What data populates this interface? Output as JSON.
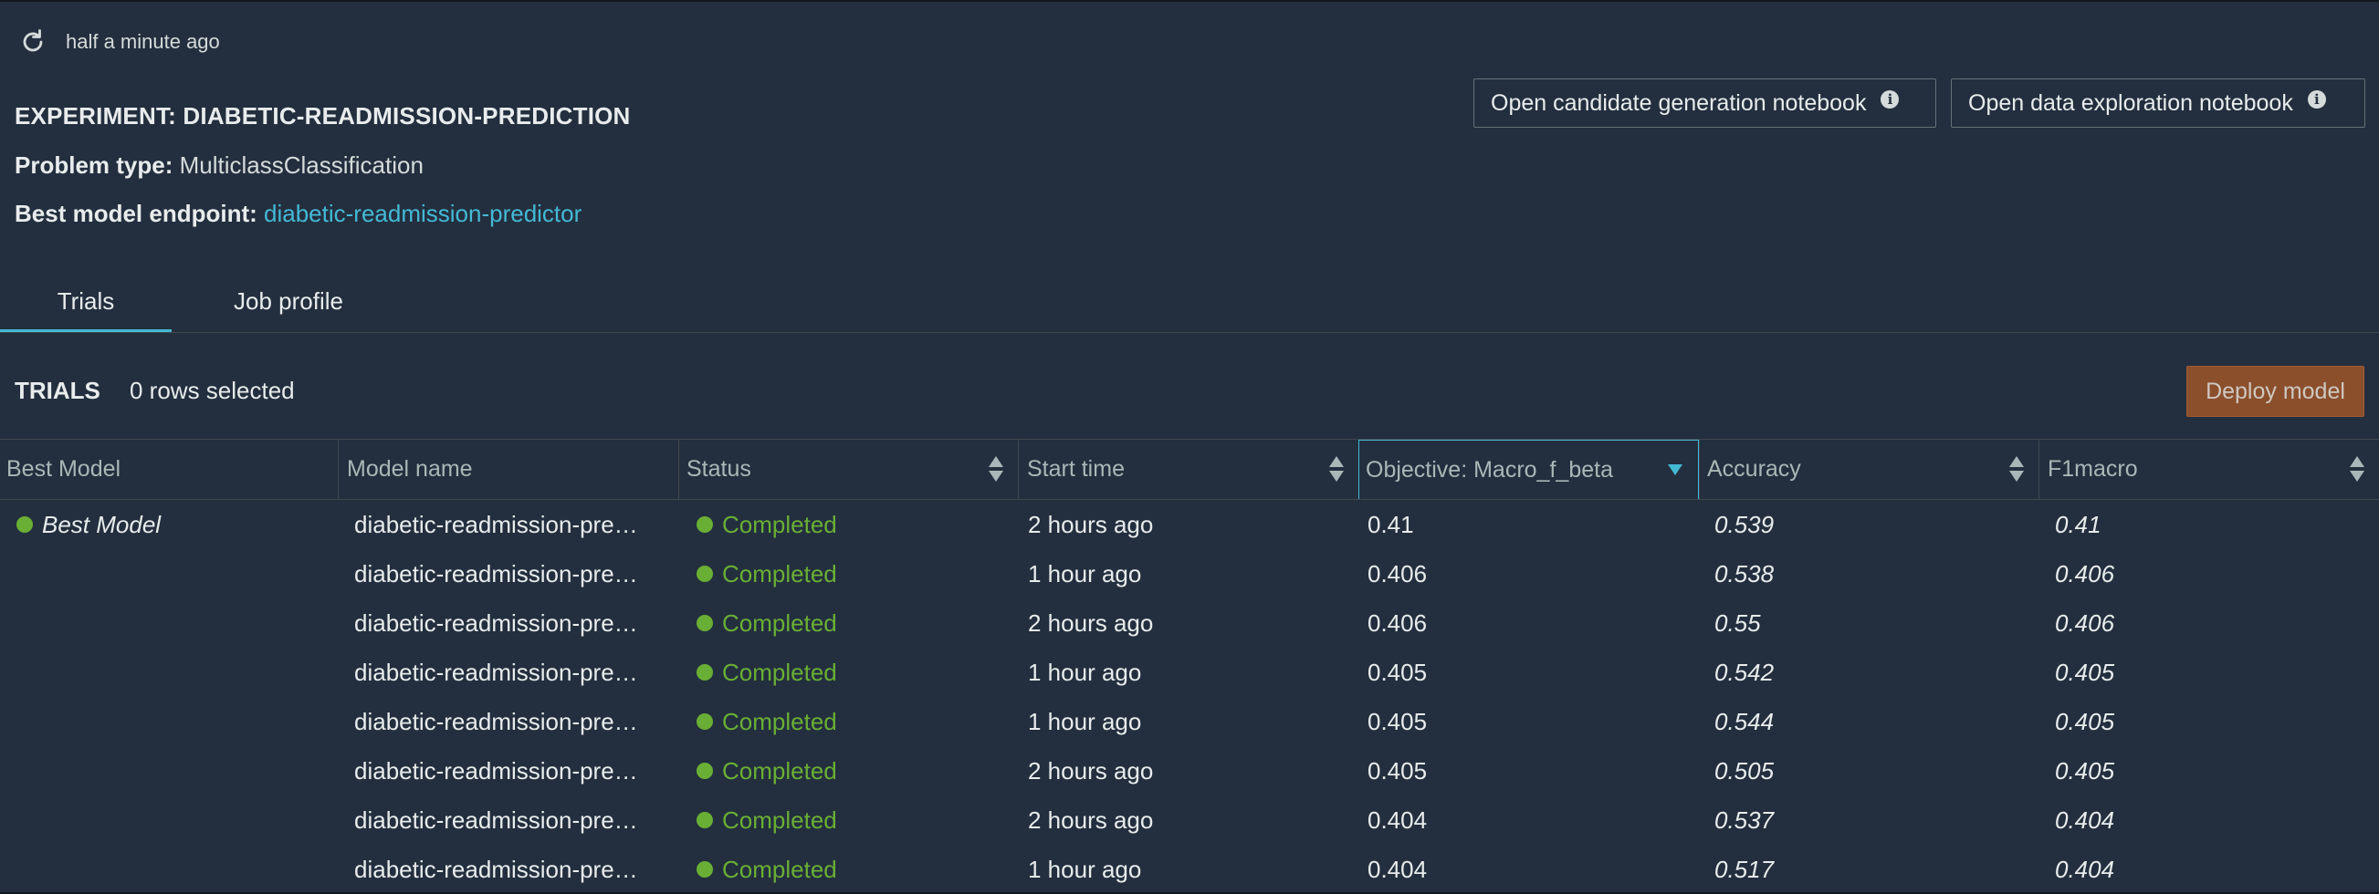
{
  "header": {
    "refresh_text": "half a minute ago",
    "experiment_title": "EXPERIMENT: DIABETIC-READMISSION-PREDICTION",
    "problem_type_label": "Problem type:",
    "problem_type_value": "MulticlassClassification",
    "endpoint_label": "Best model endpoint:",
    "endpoint_value": "diabetic-readmission-predictor"
  },
  "actions": {
    "candidate_notebook": "Open candidate generation notebook",
    "data_notebook": "Open data exploration notebook"
  },
  "tabs": [
    {
      "label": "Trials",
      "active": true
    },
    {
      "label": "Job profile",
      "active": false
    }
  ],
  "trials": {
    "title": "TRIALS",
    "rows_selected": "0 rows selected",
    "deploy_label": "Deploy model",
    "columns": [
      "Best Model",
      "Model name",
      "Status",
      "Start time",
      "Objective: Macro_f_beta",
      "Accuracy",
      "F1macro"
    ],
    "rows": [
      {
        "best": "Best Model",
        "name": "diabetic-readmission-pre…",
        "status": "Completed",
        "start": "2 hours ago",
        "objective": "0.41",
        "accuracy": "0.539",
        "f1": "0.41"
      },
      {
        "best": "",
        "name": "diabetic-readmission-pre…",
        "status": "Completed",
        "start": "1 hour ago",
        "objective": "0.406",
        "accuracy": "0.538",
        "f1": "0.406"
      },
      {
        "best": "",
        "name": "diabetic-readmission-pre…",
        "status": "Completed",
        "start": "2 hours ago",
        "objective": "0.406",
        "accuracy": "0.55",
        "f1": "0.406"
      },
      {
        "best": "",
        "name": "diabetic-readmission-pre…",
        "status": "Completed",
        "start": "1 hour ago",
        "objective": "0.405",
        "accuracy": "0.542",
        "f1": "0.405"
      },
      {
        "best": "",
        "name": "diabetic-readmission-pre…",
        "status": "Completed",
        "start": "1 hour ago",
        "objective": "0.405",
        "accuracy": "0.544",
        "f1": "0.405"
      },
      {
        "best": "",
        "name": "diabetic-readmission-pre…",
        "status": "Completed",
        "start": "2 hours ago",
        "objective": "0.405",
        "accuracy": "0.505",
        "f1": "0.405"
      },
      {
        "best": "",
        "name": "diabetic-readmission-pre…",
        "status": "Completed",
        "start": "2 hours ago",
        "objective": "0.404",
        "accuracy": "0.537",
        "f1": "0.404"
      },
      {
        "best": "",
        "name": "diabetic-readmission-pre…",
        "status": "Completed",
        "start": "1 hour ago",
        "objective": "0.404",
        "accuracy": "0.517",
        "f1": "0.404"
      }
    ]
  },
  "colors": {
    "background": "#232f3e",
    "accent": "#44b9d6",
    "success": "#6aaf35",
    "deploy": "#8b4f2c"
  },
  "icons": {
    "refresh": "refresh-icon",
    "info": "info-icon",
    "sort": "sort-icon",
    "sort_active": "sort-desc-icon"
  }
}
